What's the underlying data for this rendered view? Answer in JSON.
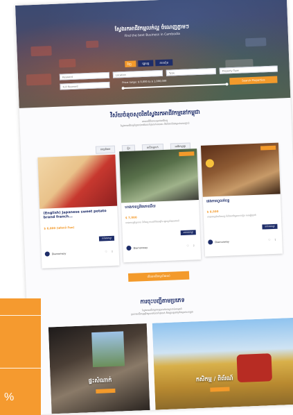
{
  "hero": {
    "title": "ស្វែងរកអាជីវកម្មលក់ល្អ ចំណេញភ្លាមៗ",
    "subtitle": "Find the best Business in Cambodia",
    "tabs": [
      "ទិញ",
      "ផ្ទេរបន្ត",
      "ភាគហ៊ុន"
    ],
    "fields": {
      "keyword": "Keyword",
      "location": "Location",
      "type": "Type",
      "property": "Property Type",
      "full_keyword": "Full Keyword"
    },
    "price_range": "Price range: $ 0,000 to $ 1,000,000",
    "search_btn": "Search Properties"
  },
  "section1": {
    "title": "វិស័យចំនុចសុចរិតស្វែងរកអាជីវកម្មនៅកម្ពុជា",
    "subtitle_1": "ធនធានឌីជីថលសម្រាប់អាជីវកម្ម",
    "subtitle_2": "ស្វែងរកអាជីវកម្មចំនួនរាប់ពាន់ដែលកំពុងលក់ពេលនេះ និងទំនាក់ទំនងម្ចាស់ដោយផ្ទាល់",
    "filters": [
      "ពេញនិយម",
      "ថ្មីៗ",
      "អាជីវកម្មលក់",
      "អាជីវកម្មផ្ទេរ"
    ]
  },
  "listings": [
    {
      "title": "(English) Japanese sweet potato brand franch...",
      "price": "$ 6,000 (នៅសល់ Fee)",
      "desc": "",
      "btn": "ទាក់ទងឥឡូវ",
      "owner": "Diamonway"
    },
    {
      "title": "ហាងកាហ្វេនិងភោជនីយ",
      "price": "$ 7,000",
      "desc": "ហាងកាហ្វេធំទូលាយ ទីតាំងល្អ មានអតិថិជនច្រើន ផ្ទេរបន្តទាំងឧបករណ៍",
      "btn": "ទាក់ទងឥឡូវ",
      "owner": "Diamonway"
    },
    {
      "title": "ផេងកាហ្វេលក់បន្ត",
      "price": "$ 8,500",
      "desc": "ហាងកាហ្វេដំណើរការល្អ ទីតាំងនៅក្បែរសាលារៀន មានភ្ញៀវប្រចាំ",
      "btn": "ទាក់ទងឥឡូវ",
      "owner": "Diamonway"
    }
  ],
  "more_button": "មើលអាជីវកម្មទាំងអស់",
  "section2": {
    "title": "ការចុះបញ្ជីតាមប្រភេទ",
    "subtitle_1": "ស្វែងរកអាជីវកម្មតាមប្រភេទដែលអ្នកចាប់អារម្មណ៍",
    "subtitle_2": "ប្រភេទអាជីវកម្មច្រើនប្រភេទដែលកំពុងលក់ និងផ្ទេរបន្តនៅទូទាំងប្រទេសកម្ពុជា",
    "categories": [
      {
        "label": "ផ្ទះសំណាក់"
      },
      {
        "label": "កសិកម្ម / ពិព័រណ៍"
      }
    ]
  },
  "side_panel": {
    "percent": "%"
  },
  "colors": {
    "accent": "#f39a2b",
    "navy": "#1e2d69",
    "panel": "#f59a2f"
  }
}
